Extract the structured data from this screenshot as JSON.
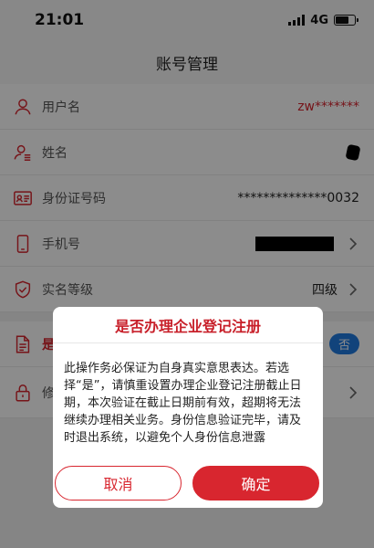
{
  "status_bar": {
    "time": "21:01",
    "network": "4G"
  },
  "header": {
    "title": "账号管理"
  },
  "rows": [
    {
      "label": "用户名",
      "value": "zw*******",
      "icon": "user-icon"
    },
    {
      "label": "姓名",
      "value": "",
      "icon": "user-list-icon"
    },
    {
      "label": "身份证号码",
      "value": "**************0032",
      "icon": "id-card-icon"
    },
    {
      "label": "手机号",
      "value": "",
      "icon": "phone-icon"
    },
    {
      "label": "实名等级",
      "value": "四级",
      "icon": "shield-icon"
    },
    {
      "label": "是",
      "value": "否",
      "icon": "document-icon"
    },
    {
      "label": "修",
      "value": "",
      "icon": "lock-icon"
    }
  ],
  "dialog": {
    "title": "是否办理企业登记注册",
    "body": "此操作务必保证为自身真实意思表达。若选择“是”，请慎重设置办理企业登记注册截止日期，本次验证在截止日期前有效，超期将无法继续办理相关业务。身份信息验证完毕，请及时退出系统，以避免个人身份信息泄露",
    "cancel_label": "取消",
    "confirm_label": "确定"
  },
  "colors": {
    "accent": "#d8262f",
    "toggle": "#1f7ae0"
  }
}
